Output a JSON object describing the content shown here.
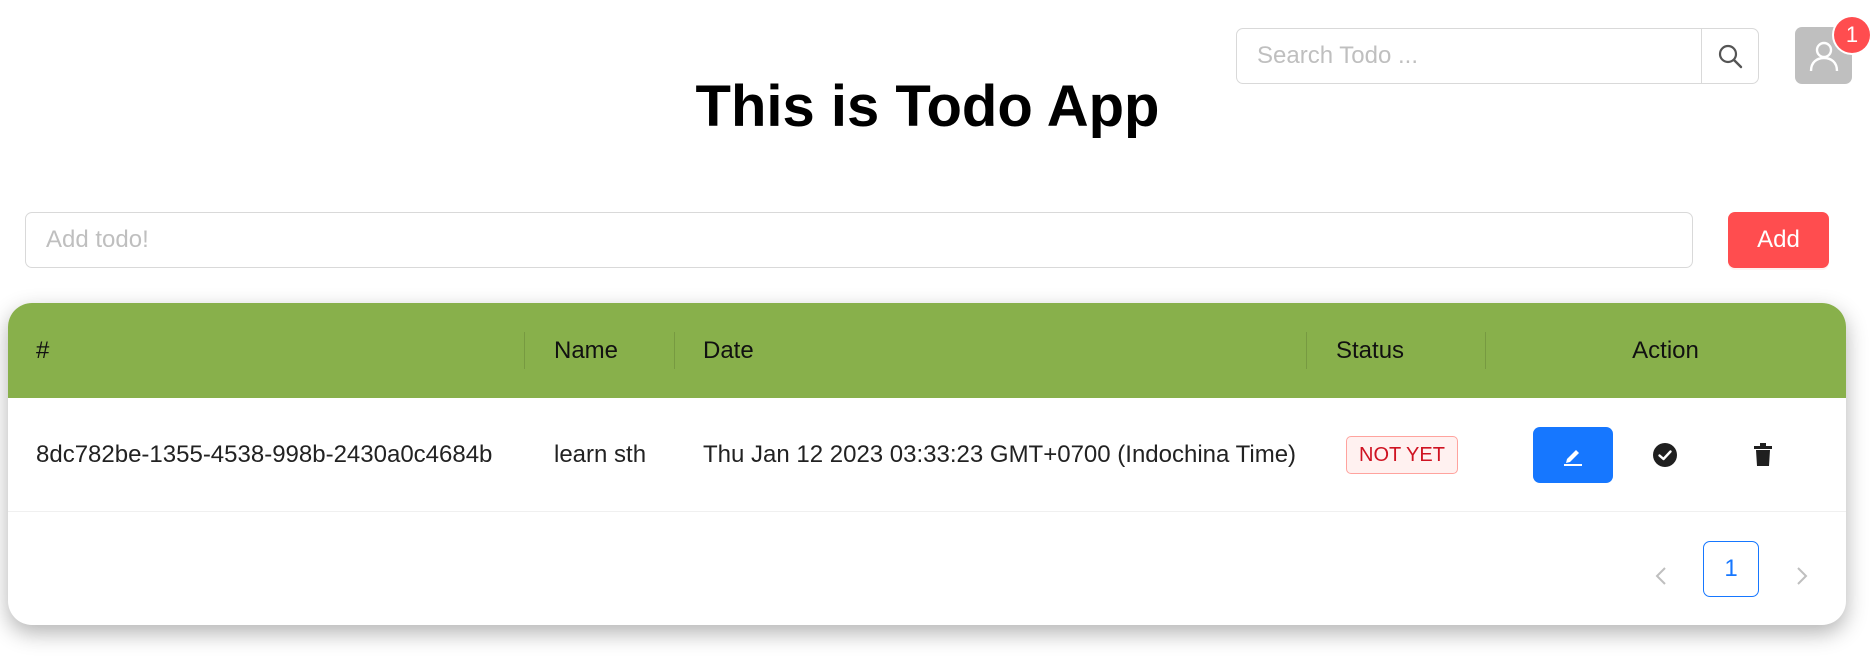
{
  "header": {
    "search": {
      "placeholder": "Search Todo ...",
      "icon": "search-icon"
    },
    "avatar": {
      "icon": "user-icon",
      "notification_count": "1"
    },
    "title": "This is Todo App"
  },
  "add_form": {
    "placeholder": "Add todo!",
    "button_label": "Add"
  },
  "table": {
    "columns": [
      "#",
      "Name",
      "Date",
      "Status",
      "Action"
    ],
    "rows": [
      {
        "id": "8dc782be-1355-4538-998b-2430a0c4684b",
        "name": "learn sth",
        "date": "Thu Jan 12 2023 03:33:23 GMT+0700 (Indochina Time)",
        "status": "NOT YET",
        "actions": [
          "edit-icon",
          "check-circle-icon",
          "delete-icon"
        ]
      }
    ]
  },
  "pagination": {
    "current_page": "1",
    "prev_icon": "chevron-left-icon",
    "next_icon": "chevron-right-icon"
  },
  "colors": {
    "header_green": "#88b04b",
    "accent_red": "#ff4d4f",
    "primary_blue": "#1677ff",
    "status_red": "#cf1322"
  }
}
